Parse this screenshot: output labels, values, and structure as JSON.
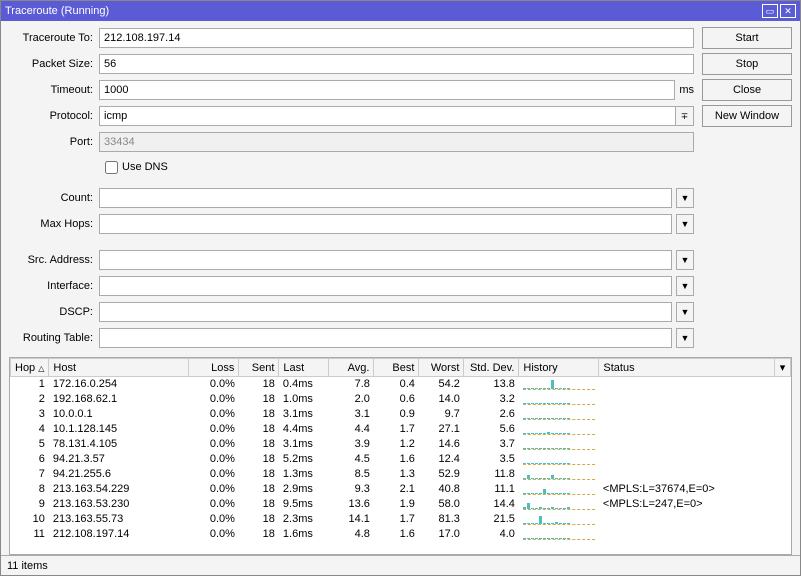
{
  "window": {
    "title": "Traceroute (Running)"
  },
  "buttons": {
    "start": "Start",
    "stop": "Stop",
    "close": "Close",
    "new_window": "New Window"
  },
  "form": {
    "traceroute_to": {
      "label": "Traceroute To:",
      "value": "212.108.197.14"
    },
    "packet_size": {
      "label": "Packet Size:",
      "value": "56"
    },
    "timeout": {
      "label": "Timeout:",
      "value": "1000",
      "suffix": "ms"
    },
    "protocol": {
      "label": "Protocol:",
      "value": "icmp"
    },
    "port": {
      "label": "Port:",
      "value": "33434"
    },
    "use_dns": {
      "label": "Use DNS",
      "checked": false
    },
    "count": {
      "label": "Count:",
      "value": ""
    },
    "max_hops": {
      "label": "Max Hops:",
      "value": ""
    },
    "src_address": {
      "label": "Src. Address:",
      "value": ""
    },
    "interface": {
      "label": "Interface:",
      "value": ""
    },
    "dscp": {
      "label": "DSCP:",
      "value": ""
    },
    "routing_table": {
      "label": "Routing Table:",
      "value": ""
    }
  },
  "table": {
    "columns": {
      "hop": "Hop",
      "host": "Host",
      "loss": "Loss",
      "sent": "Sent",
      "last": "Last",
      "avg": "Avg.",
      "best": "Best",
      "worst": "Worst",
      "stddev": "Std. Dev.",
      "history": "History",
      "status": "Status"
    },
    "rows": [
      {
        "hop": "1",
        "host": "172.16.0.254",
        "loss": "0.0%",
        "sent": "18",
        "last": "0.4ms",
        "avg": "7.8",
        "best": "0.4",
        "worst": "54.2",
        "stddev": "13.8",
        "history": [
          1,
          1,
          1,
          1,
          1,
          1,
          1,
          9,
          1,
          1,
          1,
          1
        ],
        "status": ""
      },
      {
        "hop": "2",
        "host": "192.168.62.1",
        "loss": "0.0%",
        "sent": "18",
        "last": "1.0ms",
        "avg": "2.0",
        "best": "0.6",
        "worst": "14.0",
        "stddev": "3.2",
        "history": [
          1,
          1,
          1,
          1,
          1,
          1,
          1,
          1,
          1,
          1,
          1,
          1
        ],
        "status": ""
      },
      {
        "hop": "3",
        "host": "10.0.0.1",
        "loss": "0.0%",
        "sent": "18",
        "last": "3.1ms",
        "avg": "3.1",
        "best": "0.9",
        "worst": "9.7",
        "stddev": "2.6",
        "history": [
          1,
          1,
          1,
          1,
          1,
          1,
          1,
          1,
          1,
          1,
          1,
          1
        ],
        "status": ""
      },
      {
        "hop": "4",
        "host": "10.1.128.145",
        "loss": "0.0%",
        "sent": "18",
        "last": "4.4ms",
        "avg": "4.4",
        "best": "1.7",
        "worst": "27.1",
        "stddev": "5.6",
        "history": [
          1,
          1,
          1,
          1,
          1,
          1,
          2,
          1,
          1,
          1,
          1,
          1
        ],
        "status": ""
      },
      {
        "hop": "5",
        "host": "78.131.4.105",
        "loss": "0.0%",
        "sent": "18",
        "last": "3.1ms",
        "avg": "3.9",
        "best": "1.2",
        "worst": "14.6",
        "stddev": "3.7",
        "history": [
          1,
          1,
          1,
          1,
          1,
          1,
          1,
          1,
          1,
          1,
          1,
          1
        ],
        "status": ""
      },
      {
        "hop": "6",
        "host": "94.21.3.57",
        "loss": "0.0%",
        "sent": "18",
        "last": "5.2ms",
        "avg": "4.5",
        "best": "1.6",
        "worst": "12.4",
        "stddev": "3.5",
        "history": [
          1,
          1,
          1,
          1,
          1,
          1,
          1,
          1,
          1,
          1,
          1,
          1
        ],
        "status": ""
      },
      {
        "hop": "7",
        "host": "94.21.255.6",
        "loss": "0.0%",
        "sent": "18",
        "last": "1.3ms",
        "avg": "8.5",
        "best": "1.3",
        "worst": "52.9",
        "stddev": "11.8",
        "history": [
          1,
          4,
          1,
          1,
          1,
          1,
          1,
          4,
          1,
          1,
          1,
          1
        ],
        "status": ""
      },
      {
        "hop": "8",
        "host": "213.163.54.229",
        "loss": "0.0%",
        "sent": "18",
        "last": "2.9ms",
        "avg": "9.3",
        "best": "2.1",
        "worst": "40.8",
        "stddev": "11.1",
        "history": [
          1,
          1,
          1,
          1,
          1,
          5,
          1,
          1,
          1,
          1,
          1,
          1
        ],
        "status": "<MPLS:L=37674,E=0>"
      },
      {
        "hop": "9",
        "host": "213.163.53.230",
        "loss": "0.0%",
        "sent": "18",
        "last": "9.5ms",
        "avg": "13.6",
        "best": "1.9",
        "worst": "58.0",
        "stddev": "14.4",
        "history": [
          2,
          6,
          1,
          1,
          2,
          1,
          1,
          2,
          1,
          1,
          1,
          2
        ],
        "status": "<MPLS:L=247,E=0>"
      },
      {
        "hop": "10",
        "host": "213.163.55.73",
        "loss": "0.0%",
        "sent": "18",
        "last": "2.3ms",
        "avg": "14.1",
        "best": "1.7",
        "worst": "81.3",
        "stddev": "21.5",
        "history": [
          1,
          1,
          1,
          1,
          8,
          1,
          1,
          1,
          2,
          1,
          1,
          1
        ],
        "status": ""
      },
      {
        "hop": "11",
        "host": "212.108.197.14",
        "loss": "0.0%",
        "sent": "18",
        "last": "1.6ms",
        "avg": "4.8",
        "best": "1.6",
        "worst": "17.0",
        "stddev": "4.0",
        "history": [
          1,
          1,
          1,
          1,
          1,
          1,
          1,
          1,
          1,
          1,
          1,
          1
        ],
        "status": ""
      }
    ]
  },
  "status_bar": {
    "items": "11 items"
  }
}
